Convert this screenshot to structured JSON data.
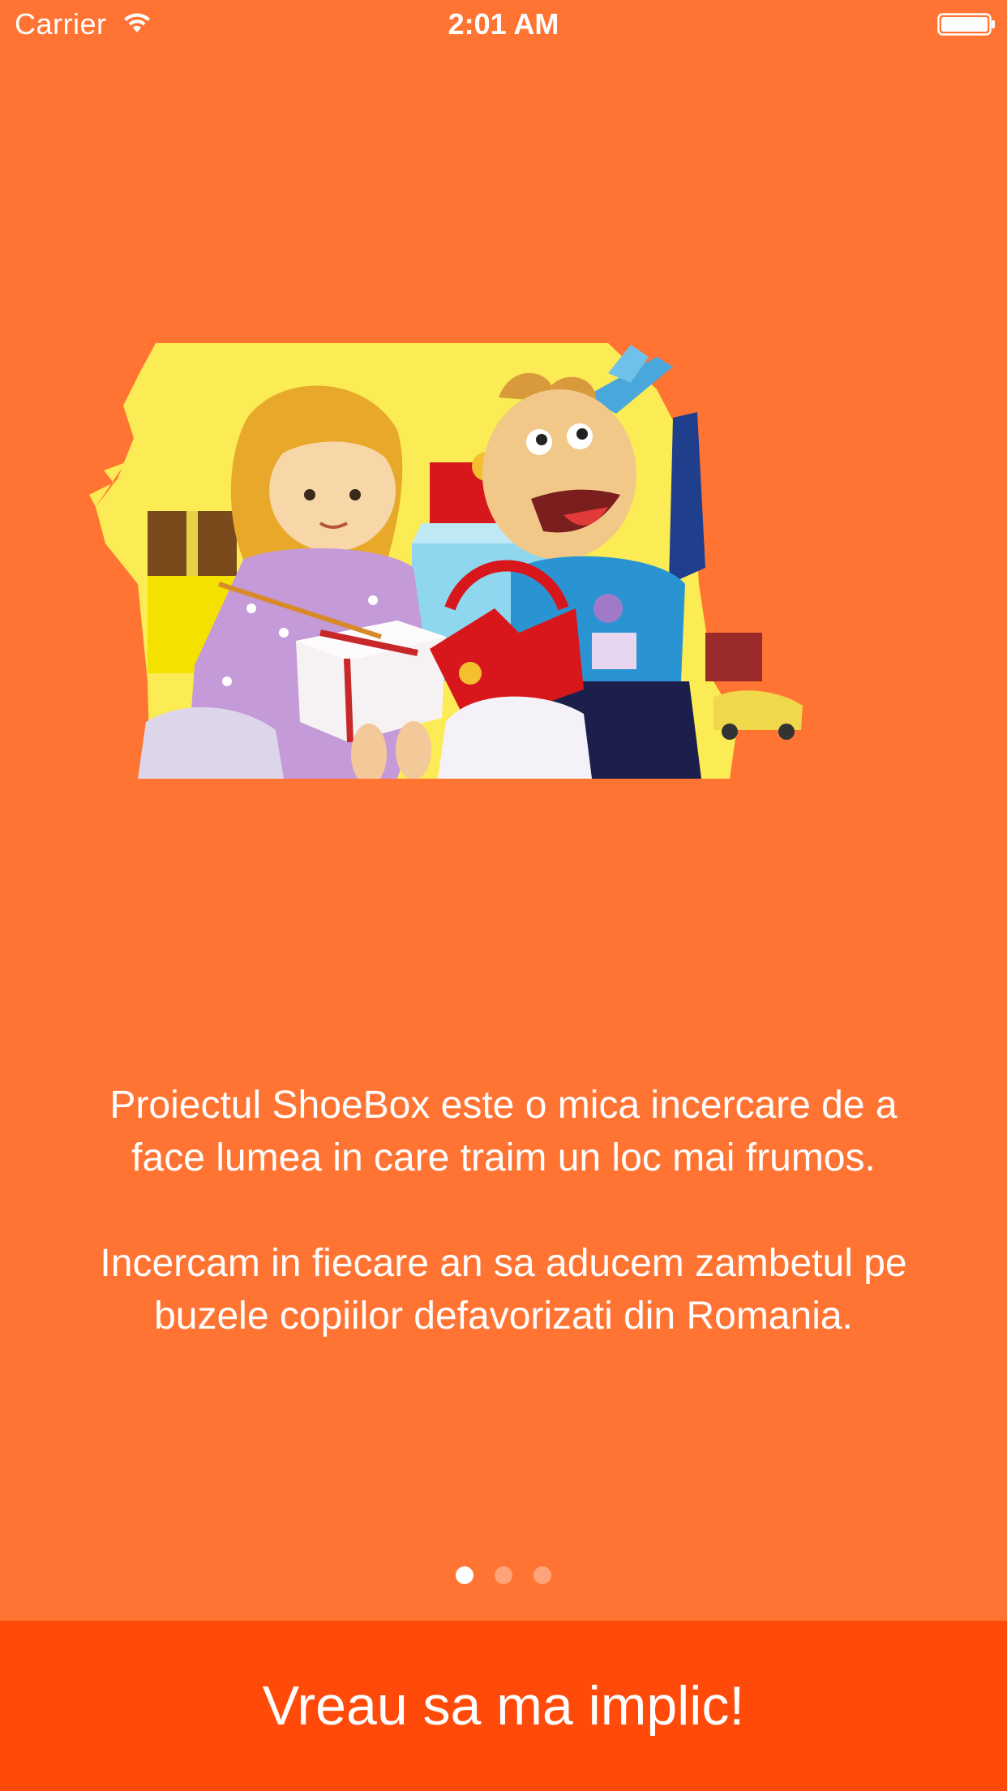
{
  "status_bar": {
    "carrier": "Carrier",
    "time": "2:01 AM",
    "wifi_icon": "wifi-icon",
    "battery_icon": "battery-icon"
  },
  "illustration": {
    "icon": "children-opening-gifts-illustration"
  },
  "description": {
    "paragraph_1": "Proiectul ShoeBox este o mica incercare de a face lumea in care traim un loc mai frumos.",
    "paragraph_2": "Incercam in fiecare an sa aducem zambetul pe buzele copiilor defavorizati din Romania."
  },
  "pager": {
    "total_pages": 3,
    "current_page": 1
  },
  "cta": {
    "label": "Vreau sa ma implic!"
  },
  "colors": {
    "background": "#ff7433",
    "button": "#ff4a0a",
    "text": "#ffffff"
  }
}
